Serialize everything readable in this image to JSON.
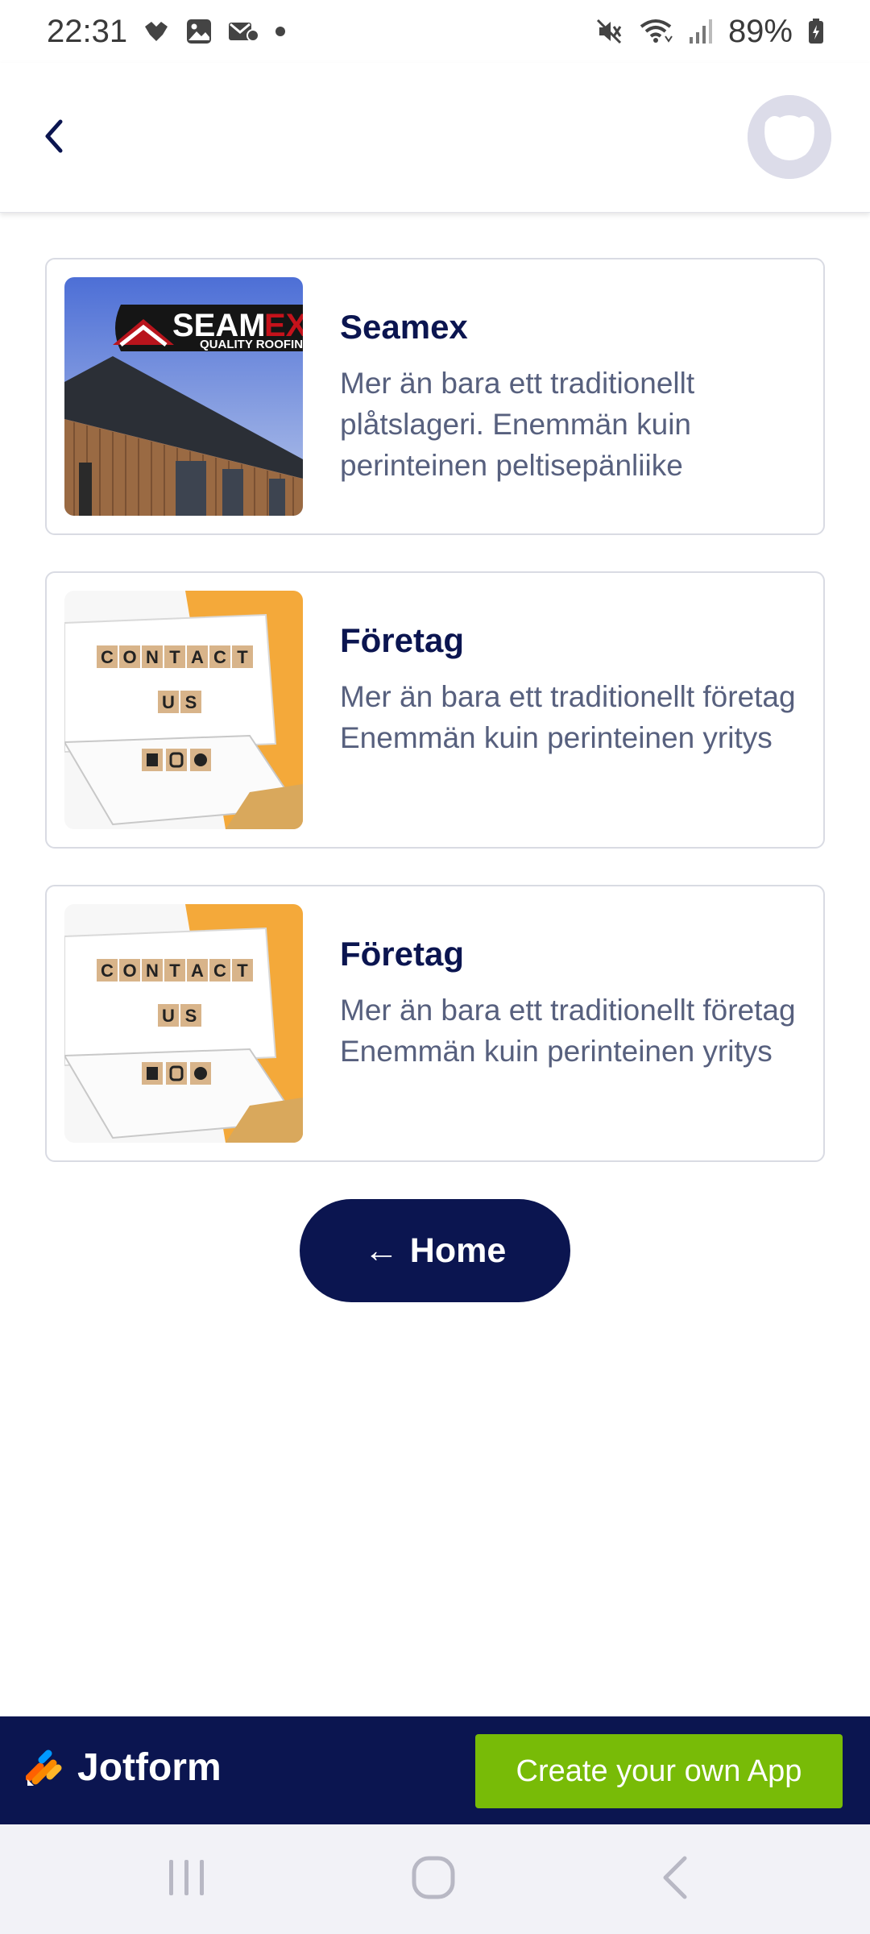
{
  "status_bar": {
    "time": "22:31",
    "battery": "89%",
    "icons_left": [
      "notification-icon",
      "gallery-icon",
      "email-icon",
      "dot-icon"
    ],
    "icons_right": [
      "mute-icon",
      "wifi-icon",
      "signal-icon",
      "battery-icon"
    ]
  },
  "header": {
    "back_icon": "chevron-left-icon",
    "avatar_icon": "app-avatar-icon"
  },
  "cards": [
    {
      "title": "Seamex",
      "description": "Mer än bara ett traditionellt plåtslageri. Enemmän kuin perinteinen peltisepänliike",
      "image_text": "SEAMEX",
      "image_subtext": "QUALITY ROOFING"
    },
    {
      "title": "Företag",
      "description": "Mer än bara ett traditionellt företag Enemmän kuin perinteinen yritys",
      "image_text": "CONTACT US"
    },
    {
      "title": "Företag",
      "description": "Mer än bara ett traditionellt företag Enemmän kuin perinteinen yritys",
      "image_text": "CONTACT US"
    }
  ],
  "home_button": {
    "arrow": "←",
    "label": "Home"
  },
  "footer": {
    "brand": "Jotform",
    "cta_label": "Create your own App"
  },
  "colors": {
    "navy": "#0b1550",
    "cta_green": "#78bb07",
    "muted_text": "#57607e"
  }
}
